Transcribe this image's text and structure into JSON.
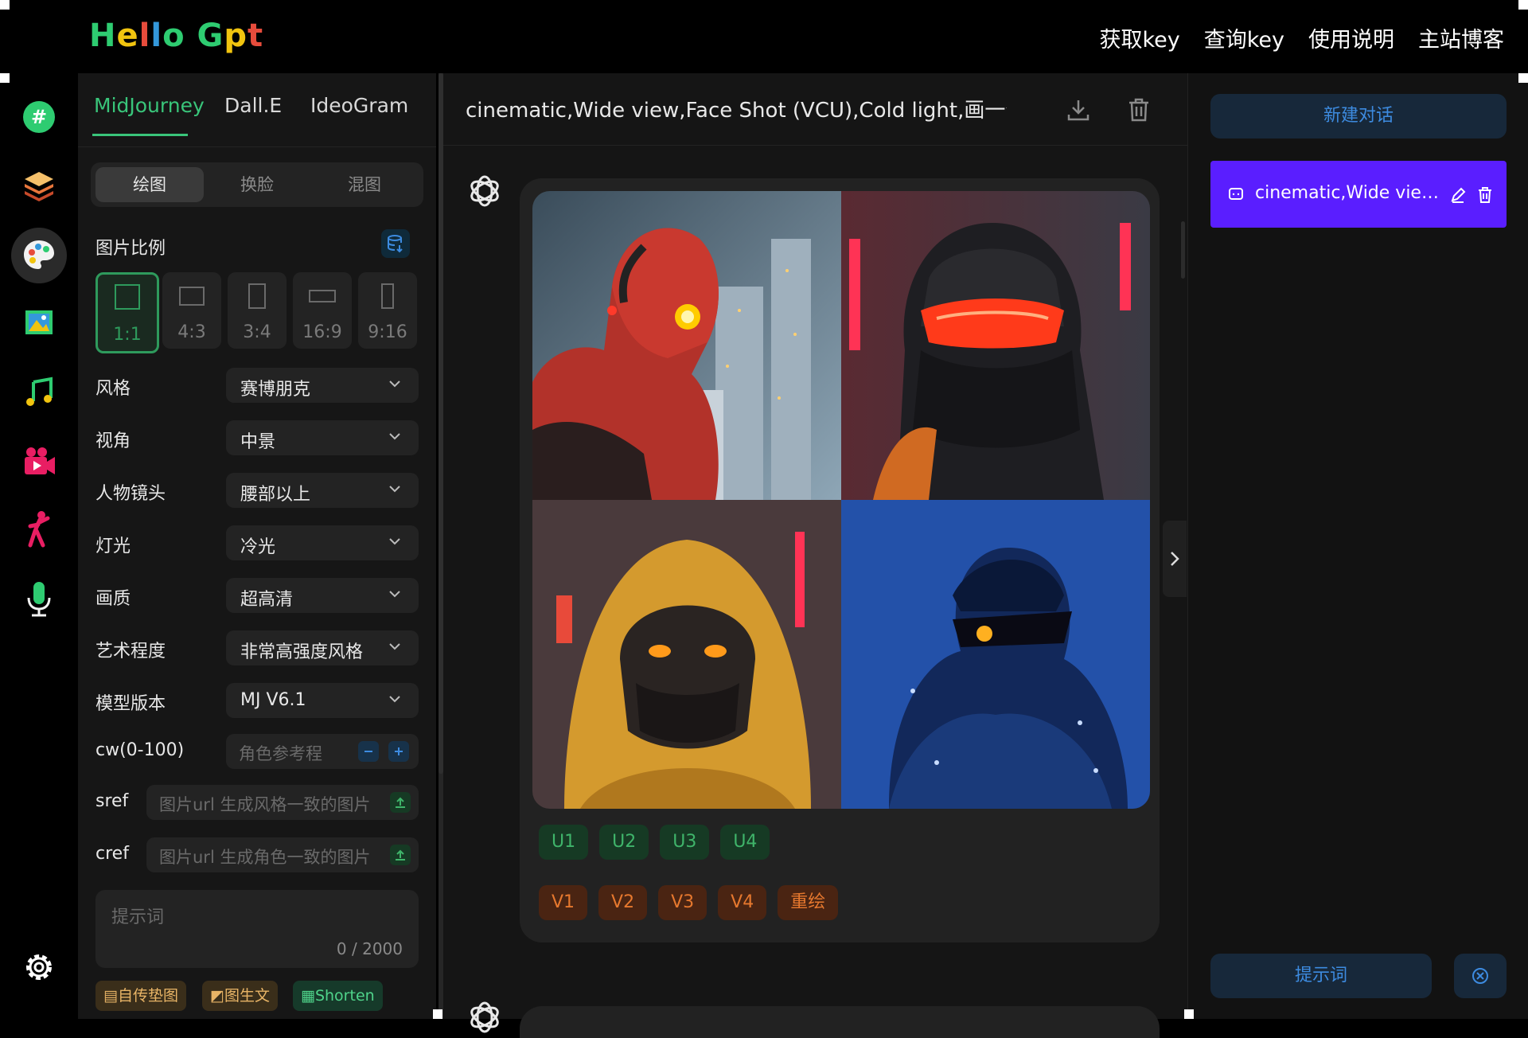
{
  "header": {
    "logo": [
      "H",
      "e",
      "l",
      "l",
      "o",
      " ",
      "G",
      "p",
      "t"
    ],
    "logo_colors": [
      "#2ecc71",
      "#f1c40f",
      "#e74c3c",
      "#3498db",
      "#2ecc71",
      "#000000",
      "#2ecc71",
      "#f1c40f",
      "#e74c3c"
    ],
    "nav": [
      "获取key",
      "查询key",
      "使用说明",
      "主站博客"
    ]
  },
  "rail": {
    "items": [
      "hashtag-icon",
      "layers-icon",
      "palette-icon",
      "image-icon",
      "music-icon",
      "video-icon",
      "dance-icon",
      "microphone-icon"
    ],
    "active": "palette-icon",
    "settings": "gear-icon"
  },
  "panel": {
    "tabs": [
      "MidJourney",
      "Dall.E",
      "IdeoGram"
    ],
    "active_tab": "MidJourney",
    "modes": [
      "绘图",
      "换脸",
      "混图"
    ],
    "active_mode": "绘图",
    "ratio_label": "图片比例",
    "ratios": [
      "1:1",
      "4:3",
      "3:4",
      "16:9",
      "9:16"
    ],
    "active_ratio": "1:1",
    "fields": [
      {
        "label": "风格",
        "value": "赛博朋克"
      },
      {
        "label": "视角",
        "value": "中景"
      },
      {
        "label": "人物镜头",
        "value": "腰部以上"
      },
      {
        "label": "灯光",
        "value": "冷光"
      },
      {
        "label": "画质",
        "value": "超高清"
      },
      {
        "label": "艺术程度",
        "value": "非常高强度风格"
      },
      {
        "label": "模型版本",
        "value": "MJ V6.1"
      }
    ],
    "cw": {
      "label": "cw(0-100)",
      "placeholder": "角色参考程"
    },
    "sref": {
      "label": "sref",
      "placeholder": "图片url 生成风格一致的图片"
    },
    "cref": {
      "label": "cref",
      "placeholder": "图片url 生成角色一致的图片"
    },
    "prompt": {
      "placeholder": "提示词",
      "count": "0 / 2000"
    },
    "chips": [
      "自传垫图",
      "图生文",
      "Shorten"
    ]
  },
  "chat": {
    "title": "cinematic,Wide view,Face Shot (VCU),Cold light,画一个...",
    "u_buttons": [
      "U1",
      "U2",
      "U3",
      "U4"
    ],
    "v_buttons": [
      "V1",
      "V2",
      "V3",
      "V4",
      "重绘"
    ]
  },
  "sidebar": {
    "new_chat": "新建对话",
    "conversation": "cinematic,Wide view,Face Shot (VCU),Cold light",
    "bottom_button": "提示词"
  }
}
